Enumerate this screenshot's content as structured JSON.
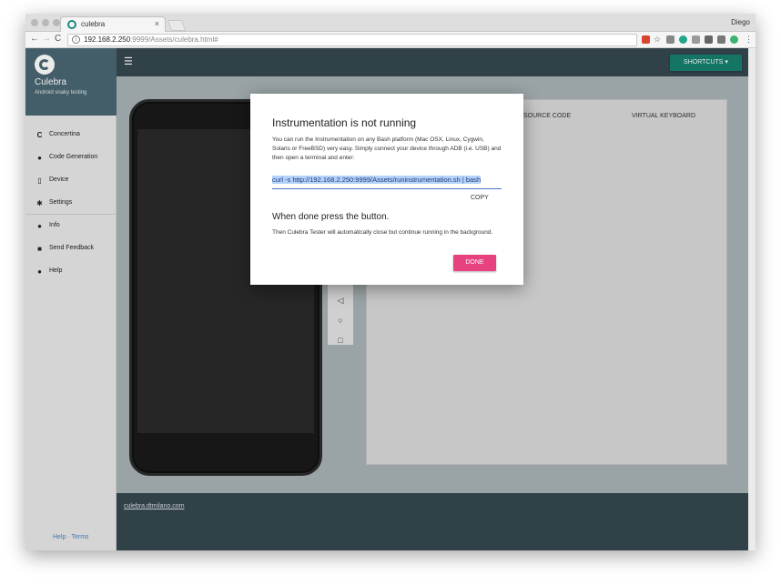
{
  "browser": {
    "tab_title": "culebra",
    "tab_close": "×",
    "user": "Diego",
    "url_host": "192.168.2.250",
    "url_path": ":9999/Assets/culebra.html#"
  },
  "sidebar": {
    "brand": "Culebra",
    "tagline": "Android snaky testing",
    "items": [
      {
        "label": "Concertina",
        "icon": "culebra-icon"
      },
      {
        "label": "Code Generation",
        "icon": "dot-icon"
      },
      {
        "label": "Device",
        "icon": "phone-icon"
      },
      {
        "label": "Settings",
        "icon": "gear-icon"
      },
      {
        "label": "Info",
        "icon": "info-icon"
      },
      {
        "label": "Send Feedback",
        "icon": "feedback-icon"
      },
      {
        "label": "Help",
        "icon": "help-icon"
      }
    ],
    "footer": "Help · Terms"
  },
  "topbar": {
    "menu_icon": "menu-icon",
    "shortcuts_label": "SHORTCUTS ▾"
  },
  "panel": {
    "tabs": [
      "SOURCE CODE",
      "VIRTUAL KEYBOARD"
    ]
  },
  "footer": {
    "link": "culebra.dtmilano.com"
  },
  "dialog": {
    "title": "Instrumentation is not running",
    "text": "You can run the Instrumentation on any Bash platform (Mac OSX, Linux, Cygwin, Solaris or FreeBSD) very easy. Simply connect your device through ADB (i.e. USB) and then open a terminal and enter:",
    "command": "curl -s http://192.168.2.250:9999/Assets/runinstrumentation.sh | bash",
    "copy_label": "COPY",
    "title2": "When done press the button.",
    "text2": "Then Culebra Tester will automatically close but continue running in the background.",
    "done_label": "DONE"
  },
  "colors": {
    "header": "#36474f",
    "sidebar_header": "#4a6772",
    "accent": "#167f6d",
    "done": "#e8417f"
  }
}
